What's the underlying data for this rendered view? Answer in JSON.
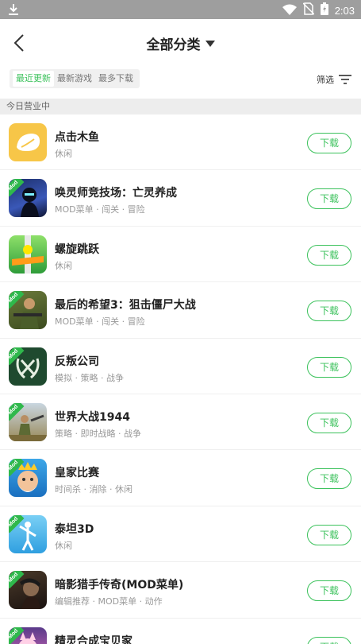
{
  "status_bar": {
    "time": "2:03"
  },
  "header": {
    "title": "全部分类"
  },
  "sort_tabs": [
    {
      "label": "最近更新",
      "active": true
    },
    {
      "label": "最新游戏",
      "active": false
    },
    {
      "label": "最多下载",
      "active": false
    }
  ],
  "filter": {
    "label": "筛选"
  },
  "section": {
    "title": "今日营业中"
  },
  "mod_badge": "Mod",
  "apps": [
    {
      "name": "点击木鱼",
      "tags": "休闲",
      "button": "下载",
      "mod": false,
      "icon": "wooden-fish"
    },
    {
      "name": "唤灵师竞技场：亡灵养成",
      "tags": "MOD菜单 · 闯关 · 冒险",
      "button": "下载",
      "mod": true,
      "icon": "ninja"
    },
    {
      "name": "螺旋跳跃",
      "tags": "休闲",
      "button": "下载",
      "mod": false,
      "icon": "helix-ball"
    },
    {
      "name": "最后的希望3：狙击僵尸大战",
      "tags": "MOD菜单 · 闯关 · 冒险",
      "button": "下载",
      "mod": true,
      "icon": "soldier"
    },
    {
      "name": "反叛公司",
      "tags": "模拟 · 策略 · 战争",
      "button": "下载",
      "mod": true,
      "icon": "rebel-wreath"
    },
    {
      "name": "世界大战1944",
      "tags": "策略 · 即时战略 · 战争",
      "button": "下载",
      "mod": true,
      "icon": "ww-soldiers"
    },
    {
      "name": "皇家比赛",
      "tags": "时间杀 · 消除 · 休闲",
      "button": "下载",
      "mod": true,
      "icon": "king"
    },
    {
      "name": "泰坦3D",
      "tags": "休闲",
      "button": "下载",
      "mod": true,
      "icon": "titan"
    },
    {
      "name": "暗影猎手传奇(MOD菜单)",
      "tags": "编辑推荐 · MOD菜单 · 动作",
      "button": "下载",
      "mod": true,
      "icon": "shadow-hunter"
    },
    {
      "name": "精灵合成宝贝家",
      "tags": "",
      "button": "下载",
      "mod": true,
      "icon": "sprite"
    }
  ],
  "colors": {
    "accent": "#3cc25c",
    "status_bar": "#9e9e9e",
    "section_bg": "#ededed"
  }
}
